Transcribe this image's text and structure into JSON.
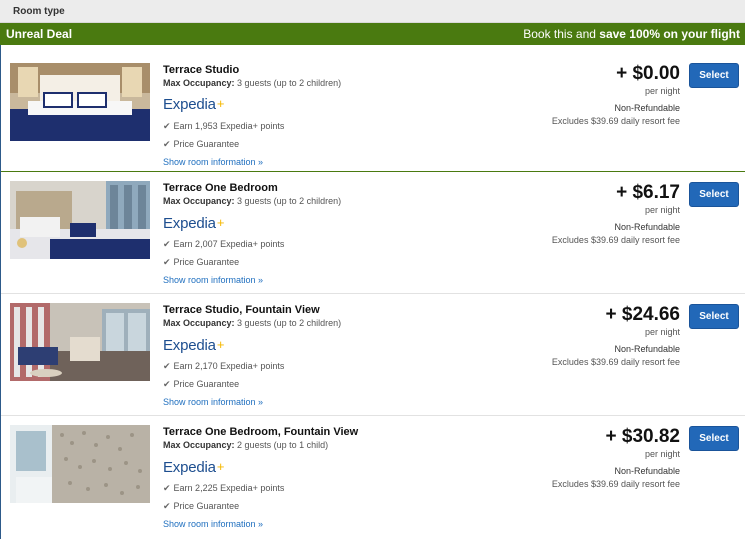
{
  "header": {
    "label": "Room type"
  },
  "deal": {
    "title": "Unreal Deal",
    "promo_prefix": "Book this and",
    "promo_bold": "save 100% on your flight"
  },
  "labels": {
    "max_occupancy": "Max Occupancy:",
    "per_night": "per night",
    "show_info": "Show room information »",
    "select": "Select",
    "expedia": "Expedia",
    "expedia_plus": "+"
  },
  "rooms": [
    {
      "name": "Terrace Studio",
      "occupancy": "3 guests (up to 2 children)",
      "earn": "Earn 1,953 Expedia+ points",
      "guarantee": "Price Guarantee",
      "price": "+ $0.00",
      "refund": "Non-Refundable",
      "resort_fee": "Excludes $39.69 daily resort fee"
    },
    {
      "name": "Terrace One Bedroom",
      "occupancy": "3 guests (up to 2 children)",
      "earn": "Earn 2,007 Expedia+ points",
      "guarantee": "Price Guarantee",
      "price": "+ $6.17",
      "refund": "Non-Refundable",
      "resort_fee": "Excludes $39.69 daily resort fee"
    },
    {
      "name": "Terrace Studio, Fountain View",
      "occupancy": "3 guests (up to 2 children)",
      "earn": "Earn 2,170 Expedia+ points",
      "guarantee": "Price Guarantee",
      "price": "+ $24.66",
      "refund": "Non-Refundable",
      "resort_fee": "Excludes $39.69 daily resort fee"
    },
    {
      "name": "Terrace One Bedroom, Fountain View",
      "occupancy": "2 guests (up to 1 child)",
      "earn": "Earn 2,225 Expedia+ points",
      "guarantee": "Price Guarantee",
      "price": "+ $30.82",
      "refund": "Non-Refundable",
      "resort_fee": "Excludes $39.69 daily resort fee"
    }
  ],
  "colors": {
    "deal_green": "#4a7a10",
    "select_blue": "#2268b8",
    "link_blue": "#1f6fbf",
    "expedia_navy": "#1d4e8f",
    "expedia_gold": "#f5b800"
  }
}
